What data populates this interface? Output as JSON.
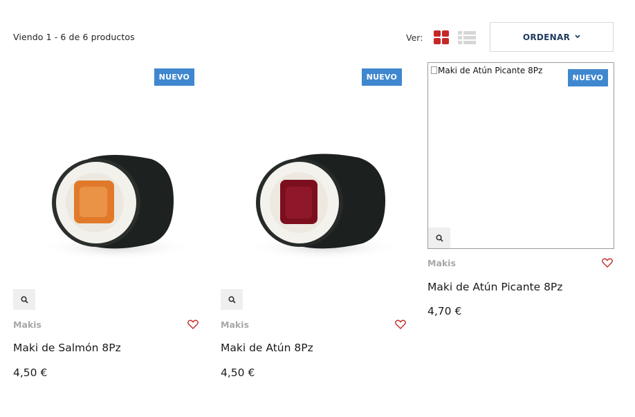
{
  "toolbar": {
    "results_text": "Viendo 1 - 6 de 6 productos",
    "view_label": "Ver:",
    "sort_label": "ORDENAR",
    "grid_icon": "grid-view-icon",
    "list_icon": "list-view-icon",
    "accent_color": "#c62828"
  },
  "products": [
    {
      "badge": "NUEVO",
      "category": "Makis",
      "name": "Maki de Salmón 8Pz",
      "price": "4,50 €",
      "image_alt": ""
    },
    {
      "badge": "NUEVO",
      "category": "Makis",
      "name": "Maki de Atún 8Pz",
      "price": "4,50 €",
      "image_alt": ""
    },
    {
      "badge": "NUEVO",
      "category": "Makis",
      "name": "Maki de Atún Picante 8Pz",
      "price": "4,70 €",
      "image_alt": "Maki de Atún Picante 8Pz"
    }
  ],
  "colors": {
    "badge_bg": "#3f87cf",
    "category_text": "#a7a7a7",
    "heart": "#c62828",
    "sort_text": "#1f3a5f"
  }
}
